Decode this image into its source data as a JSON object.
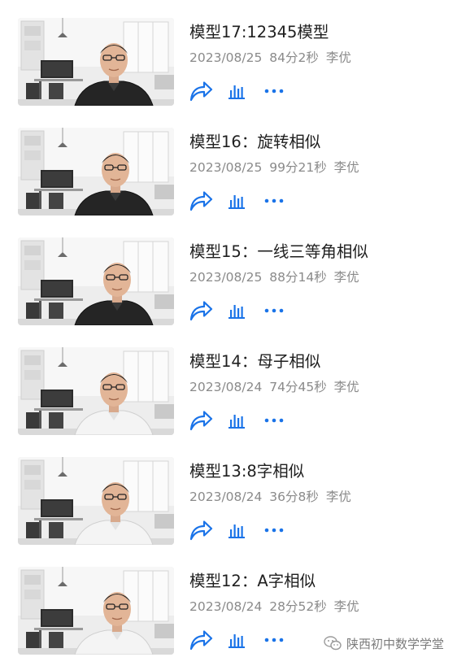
{
  "colors": {
    "accent": "#1a73e8",
    "title": "#1f1f1f",
    "meta": "#8a8a8a"
  },
  "icons": {
    "share": "share-arrow-icon",
    "stats": "bar-chart-icon",
    "more": "more-dots-icon",
    "watermark": "wechat-icon"
  },
  "items": [
    {
      "title": "模型17:12345模型",
      "date": "2023/08/25",
      "duration": "84分2秒",
      "author": "李优",
      "shirt": "dark"
    },
    {
      "title": "模型16：旋转相似",
      "date": "2023/08/25",
      "duration": "99分21秒",
      "author": "李优",
      "shirt": "dark"
    },
    {
      "title": "模型15：一线三等角相似",
      "date": "2023/08/25",
      "duration": "88分14秒",
      "author": "李优",
      "shirt": "dark"
    },
    {
      "title": "模型14：母子相似",
      "date": "2023/08/24",
      "duration": "74分45秒",
      "author": "李优",
      "shirt": "white"
    },
    {
      "title": "模型13:8字相似",
      "date": "2023/08/24",
      "duration": "36分8秒",
      "author": "李优",
      "shirt": "white"
    },
    {
      "title": "模型12：A字相似",
      "date": "2023/08/24",
      "duration": "28分52秒",
      "author": "李优",
      "shirt": "white"
    }
  ],
  "watermark": {
    "text": "陕西初中数学学堂"
  }
}
